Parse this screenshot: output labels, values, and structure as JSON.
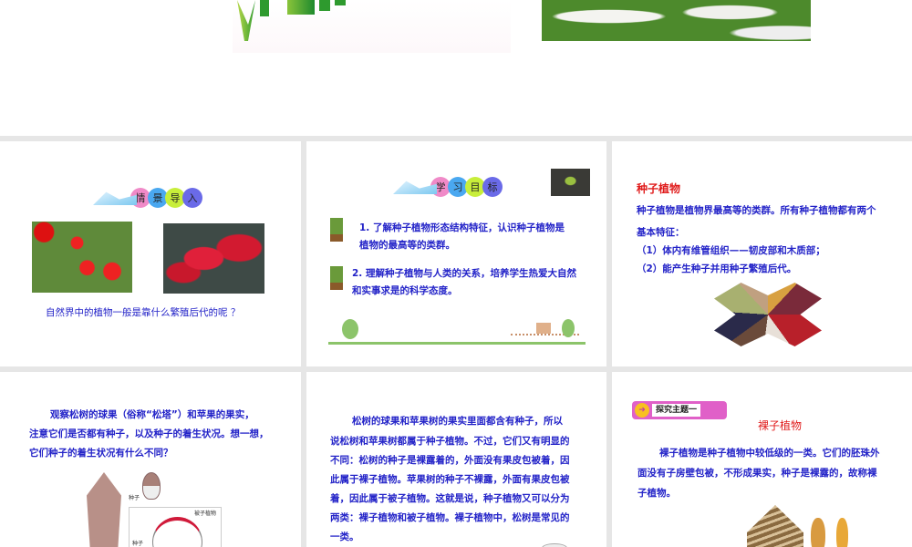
{
  "slides": [
    {
      "id": "slide-top"
    },
    {
      "banner": [
        "情",
        "景",
        "导",
        "入"
      ],
      "caption": "自然界中的植物一般是靠什么繁殖后代的呢 ？"
    },
    {
      "banner": [
        "学",
        "习",
        "目",
        "标"
      ],
      "goals": [
        "1. 了解种子植物形态结构特征，认识种子植物是",
        "植物的最高等的类群。",
        "2. 理解种子植物与人类的关系，培养学生热爱大自然",
        "和实事求是的科学态度。"
      ]
    },
    {
      "title": "种子植物",
      "lines": [
        "种子植物是植物界最高等的类群。所有种子植物都有两个",
        "基本特征：",
        "（1）体内有维管组织——韧皮部和木质部；",
        "（2）能产生种子并用种子繁殖后代。"
      ]
    },
    {
      "lines": [
        "观察松树的球果（俗称“松塔”）和苹果的果实，",
        "注意它们是否都有种子，以及种子的着生状况。想一想，",
        "它们种子的着生状况有什么不同？"
      ],
      "diagram_labels": {
        "seed1": "种子",
        "angio": "被子植物",
        "seed2": "种子"
      }
    },
    {
      "lines": [
        "松树的球果和苹果树的果实里面都含有种子，所以",
        "说松树和苹果树都属于种子植物。不过，它们又有明显的",
        "不同：松树的种子是裸露着的，外面没有果皮包被着，因",
        "此属于裸子植物。苹果树的种子不裸露，外面有果皮包被",
        "着，因此属于被子植物。这就是说，种子植物又可以分为",
        "两类：裸子植物和被子植物。裸子植物中，松树是常见的",
        "一类。"
      ]
    },
    {
      "tag": "探究主题一",
      "title": "裸子植物",
      "lines": [
        "裸子植物是种子植物中较低级的一类。它们的胚珠外",
        "面没有子房壁包被，不形成果实，种子是裸露的，故称裸",
        "子植物。"
      ]
    }
  ],
  "colors": {
    "text": "#2323c8",
    "title": "#e01b1b",
    "bg": "#e6e6e6"
  }
}
